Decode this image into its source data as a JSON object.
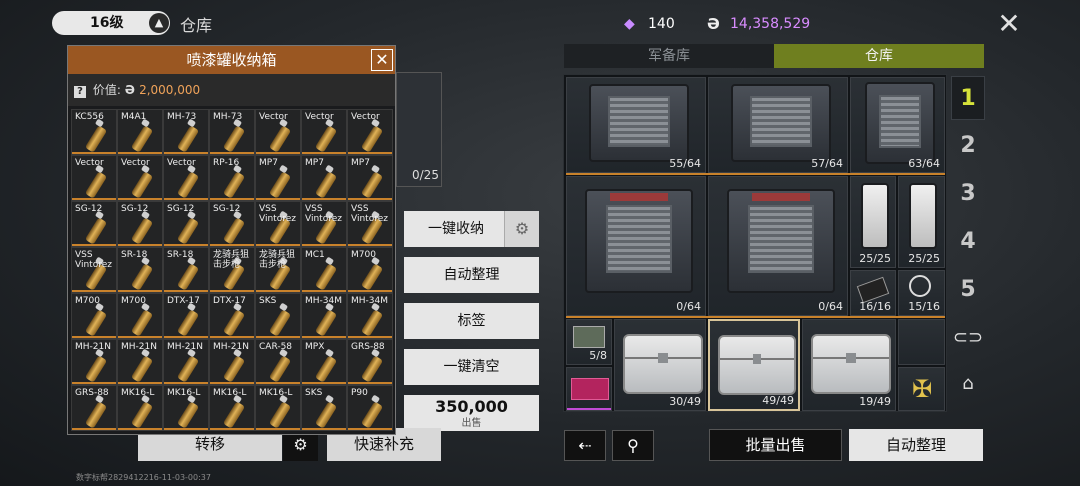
{
  "header": {
    "level": "16级",
    "level_up_icon": "arrow-up-icon",
    "title": "仓库",
    "gems": "140",
    "coins": "14,358,529",
    "accent_purple": "#d98cff"
  },
  "tabs": {
    "armory": "军备库",
    "warehouse": "仓库"
  },
  "grid": {
    "cells": [
      "55/64",
      "57/64",
      "63/64",
      "0/64",
      "0/64",
      "25/25",
      "25/25",
      "16/16",
      "15/16",
      "5/8",
      "30/49",
      "49/49",
      "19/49"
    ]
  },
  "pages": [
    "1",
    "2",
    "3",
    "4",
    "5"
  ],
  "right_bottom": {
    "batch_sell": "批量出售",
    "auto_sort": "自动整理"
  },
  "actions": {
    "one_key_store": "一键收纳",
    "auto_sort": "自动整理",
    "tag": "标签",
    "clear_all": "一键清空",
    "sell_price": "350,000",
    "sell_label": "出售"
  },
  "left_bottom": {
    "transfer": "转移",
    "quick_fill": "快速补充",
    "footer_id": "数字标帮2829412216-11-03-00:37",
    "under_count": "0/25"
  },
  "popup": {
    "title": "喷漆罐收纳箱",
    "value_label": "价值:",
    "value": "2,000,000",
    "items": [
      "KC556",
      "M4A1",
      "MH-73",
      "MH-73",
      "Vector",
      "Vector",
      "Vector",
      "Vector",
      "Vector",
      "Vector",
      "RP-16",
      "MP7",
      "MP7",
      "MP7",
      "SG-12",
      "SG-12",
      "SG-12",
      "SG-12",
      "VSS Vintorez",
      "VSS Vintorez",
      "VSS Vintorez",
      "VSS Vintorez",
      "SR-18",
      "SR-18",
      "龙骑兵狙击步枪",
      "龙骑兵狙击步枪",
      "MC1",
      "M700",
      "M700",
      "M700",
      "DTX-17",
      "DTX-17",
      "SKS",
      "MH-34M",
      "MH-34M",
      "MH-21N",
      "MH-21N",
      "MH-21N",
      "MH-21N",
      "CAR-58",
      "MPX",
      "GRS-88",
      "GRS-88",
      "MK16-L",
      "MK16-L",
      "MK16-L",
      "MK16-L",
      "SKS",
      "P90"
    ]
  }
}
